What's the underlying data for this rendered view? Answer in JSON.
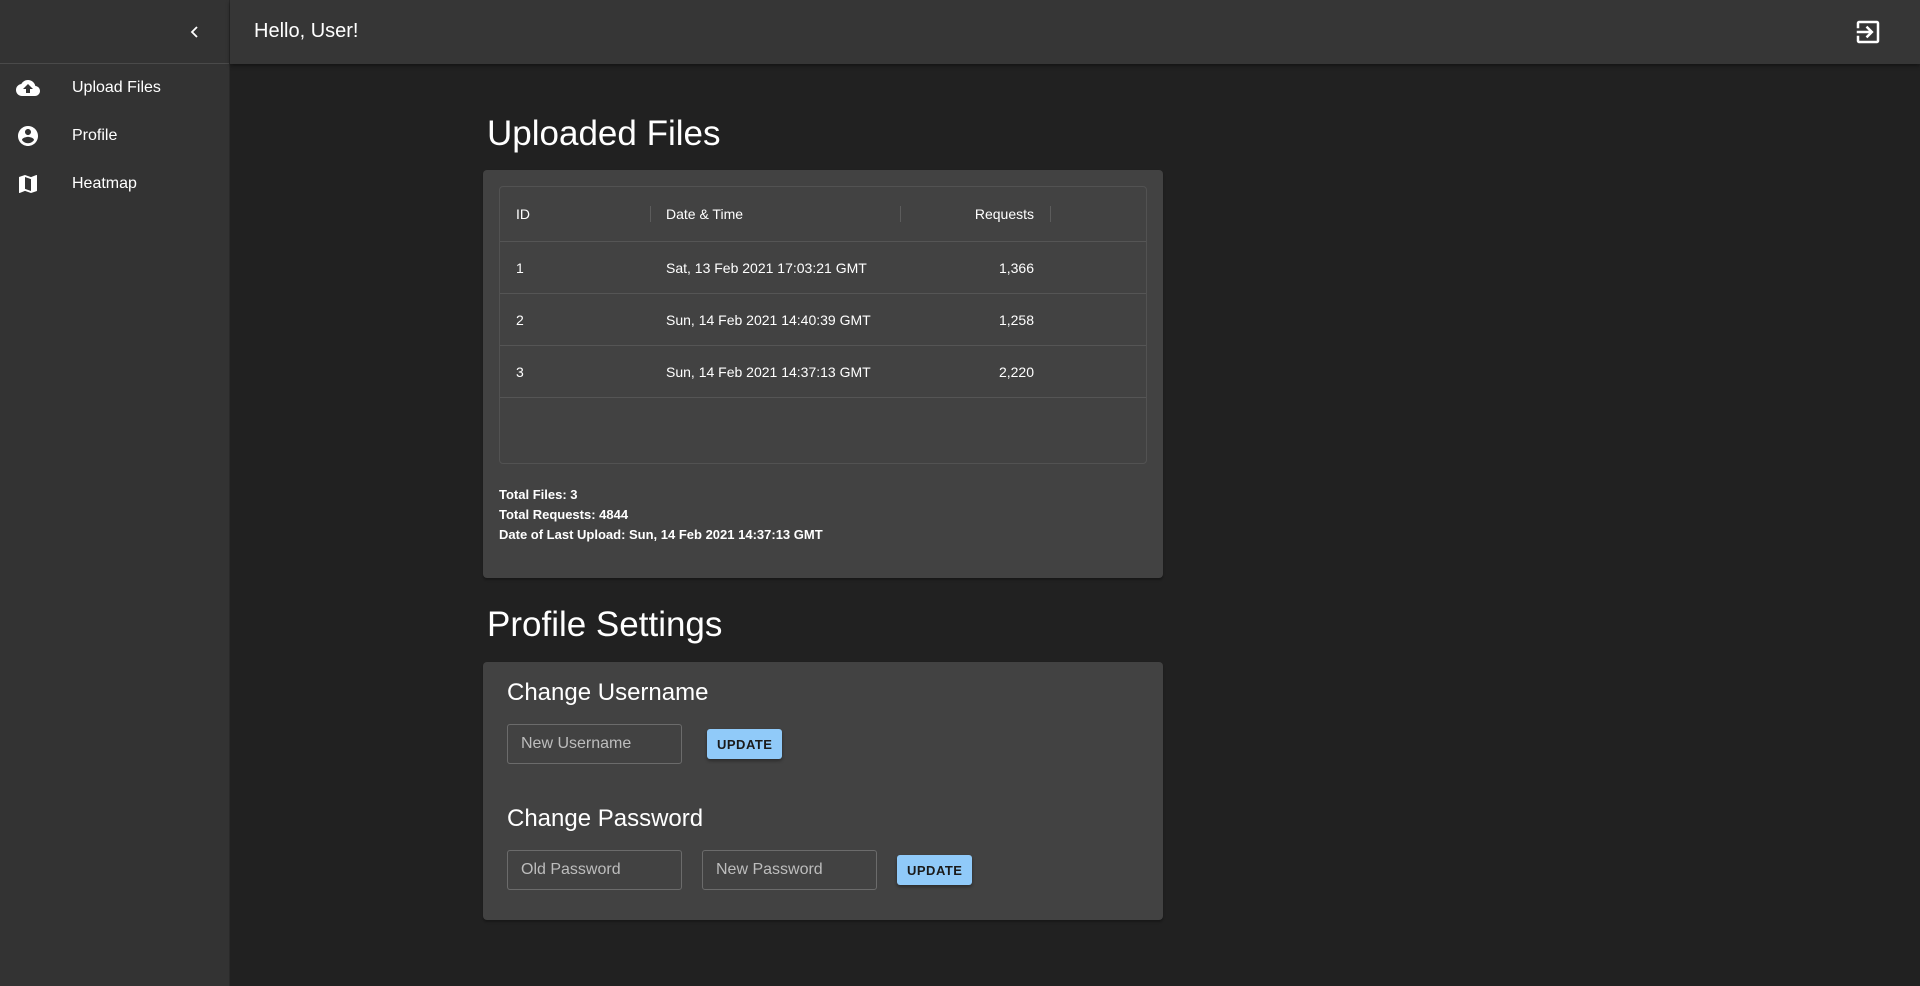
{
  "header": {
    "greeting": "Hello, User!"
  },
  "sidebar": {
    "items": [
      {
        "label": "Upload Files",
        "icon": "cloud-upload-icon"
      },
      {
        "label": "Profile",
        "icon": "account-circle-icon"
      },
      {
        "label": "Heatmap",
        "icon": "map-icon"
      }
    ]
  },
  "uploaded_files": {
    "title": "Uploaded Files",
    "columns": [
      "ID",
      "Date & Time",
      "Requests"
    ],
    "rows": [
      {
        "id": "1",
        "datetime": "Sat, 13 Feb 2021 17:03:21 GMT",
        "requests": "1,366"
      },
      {
        "id": "2",
        "datetime": "Sun, 14 Feb 2021 14:40:39 GMT",
        "requests": "1,258"
      },
      {
        "id": "3",
        "datetime": "Sun, 14 Feb 2021 14:37:13 GMT",
        "requests": "2,220"
      }
    ],
    "summary": {
      "total_files": "Total Files: 3",
      "total_requests": "Total Requests: 4844",
      "last_upload": "Date of Last Upload: Sun, 14 Feb 2021 14:37:13 GMT"
    }
  },
  "profile_settings": {
    "title": "Profile Settings",
    "change_username": {
      "heading": "Change Username",
      "placeholder": "New Username",
      "button": "UPDATE"
    },
    "change_password": {
      "heading": "Change Password",
      "old_placeholder": "Old Password",
      "new_placeholder": "New Password",
      "button": "UPDATE"
    }
  },
  "colors": {
    "background": "#212121",
    "sidebar": "#333333",
    "card": "#424242",
    "accent": "#90caf9"
  }
}
